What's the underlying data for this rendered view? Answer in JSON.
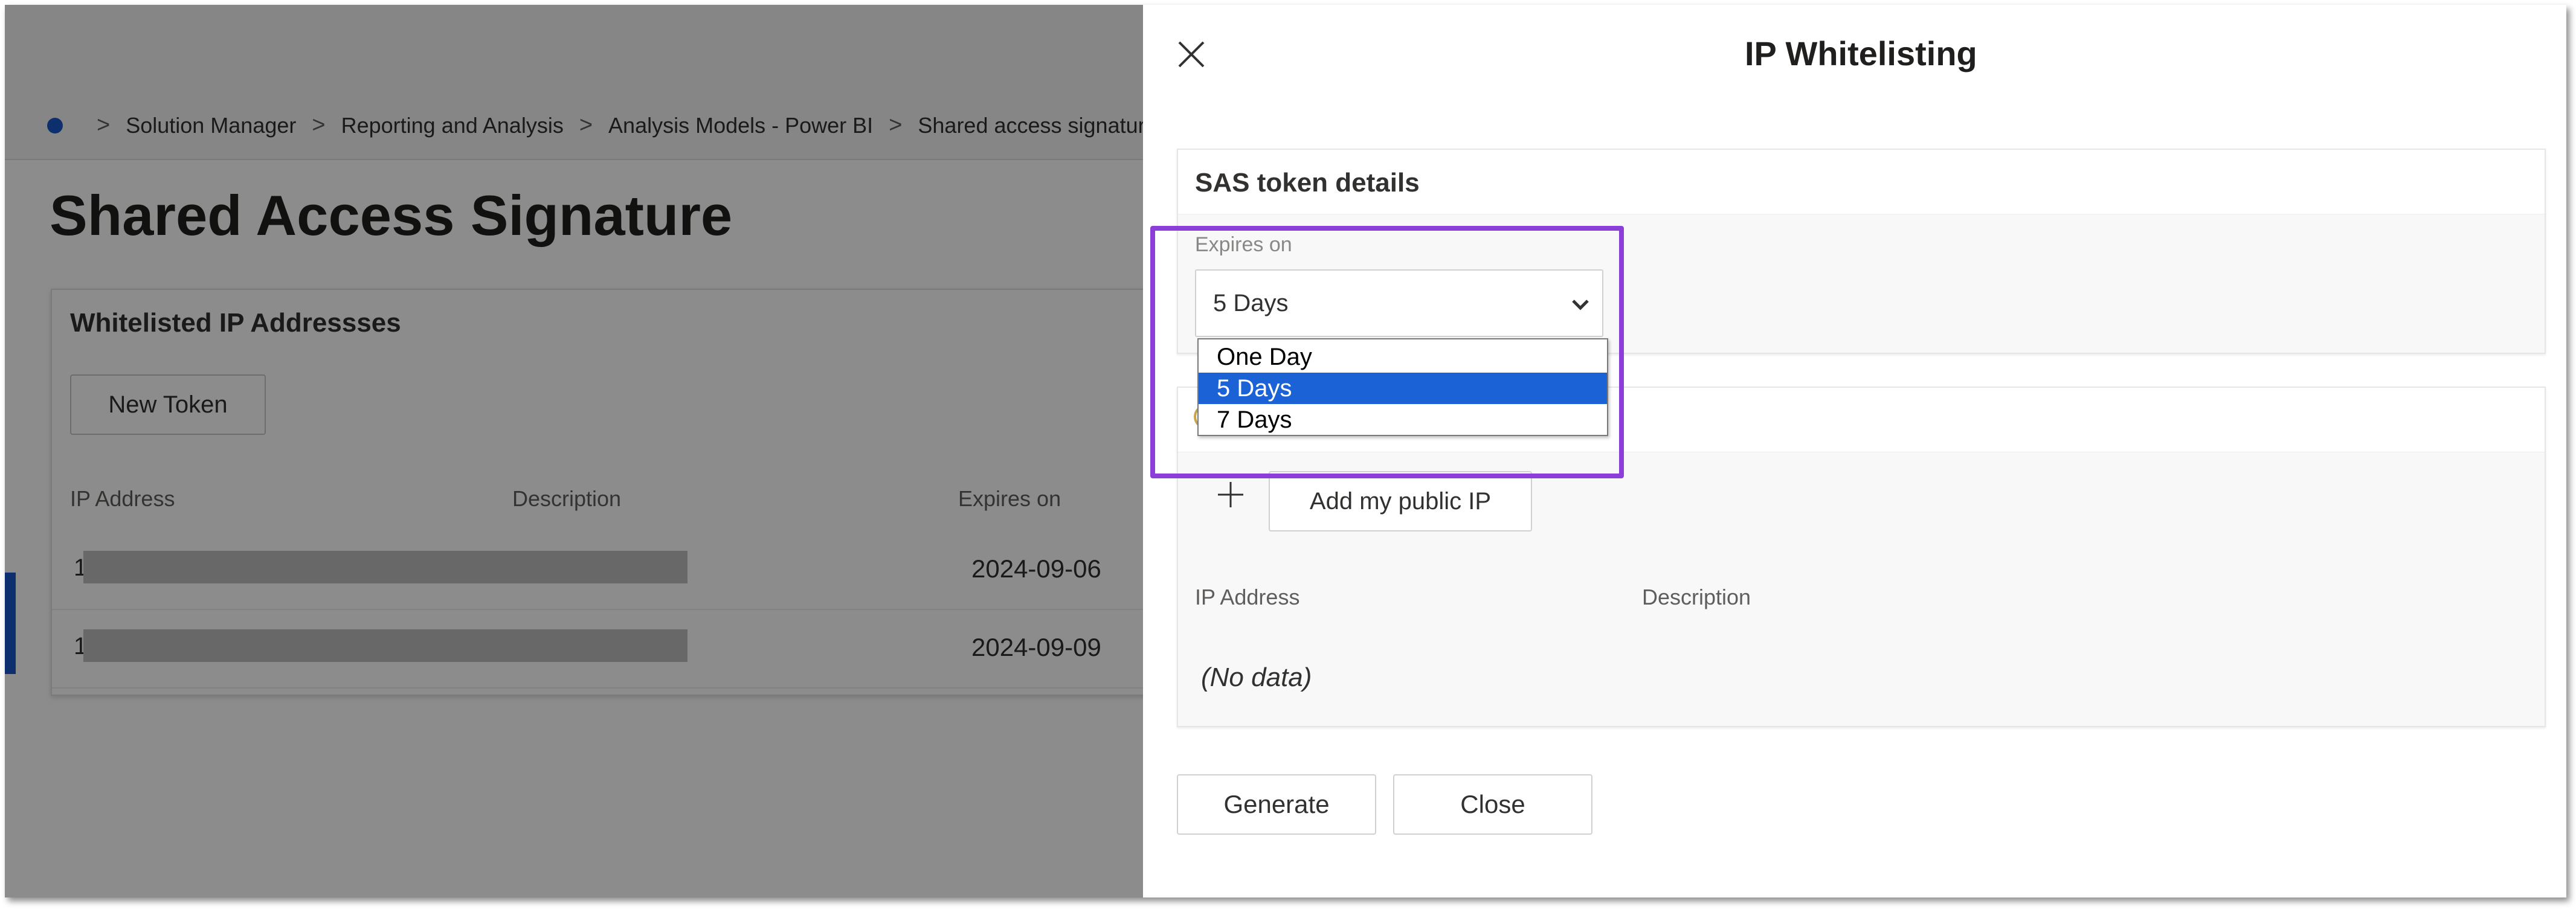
{
  "background": {
    "breadcrumb": [
      "Solution Manager",
      "Reporting and Analysis",
      "Analysis Models - Power BI",
      "Shared access signature"
    ],
    "page_title": "Shared Access Signature",
    "card_title": "Whitelisted IP Addressses",
    "new_token_label": "New Token",
    "columns": {
      "ip": "IP Address",
      "description": "Description",
      "expires": "Expires on"
    },
    "rows": [
      {
        "ip_lead": "1",
        "expires": "2024-09-06"
      },
      {
        "ip_lead": "1",
        "expires": "2024-09-09"
      }
    ]
  },
  "panel": {
    "title": "IP Whitelisting",
    "sas": {
      "section_title": "SAS token details",
      "expires_label": "Expires on",
      "selected": "5 Days",
      "options": [
        "One Day",
        "5 Days",
        "7 Days"
      ]
    },
    "ip_section": {
      "add_ip_label": "Add my public IP",
      "columns": {
        "ip": "IP Address",
        "description": "Description"
      },
      "empty_text": "(No data)"
    },
    "generate_label": "Generate",
    "close_label": "Close"
  },
  "colors": {
    "highlight": "#8b3fd8",
    "selected_option": "#1a62d6",
    "brand": "#1a56c9"
  },
  "icons": [
    "home-dot-icon",
    "chevron-right-icon",
    "close-icon",
    "chevron-down-icon",
    "plus-icon",
    "key-icon"
  ]
}
